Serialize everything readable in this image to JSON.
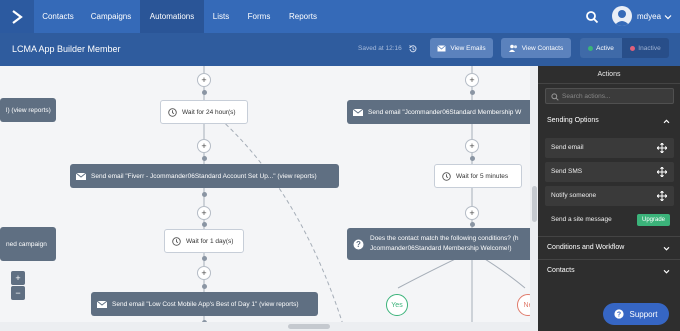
{
  "nav": {
    "items": [
      "Contacts",
      "Campaigns",
      "Automations",
      "Lists",
      "Forms",
      "Reports"
    ],
    "active": "Automations",
    "user": "mdyea"
  },
  "header": {
    "title": "LCMA App Builder Member",
    "saved": "Saved at 12:16",
    "view_emails": "View Emails",
    "view_contacts": "View Contacts",
    "active_label": "Active",
    "inactive_label": "Inactive"
  },
  "canvas": {
    "left_top_node": "l) (view reports)",
    "left_mid_node": "ned campaign",
    "wait1": "Wait for 24 hour(s)",
    "email1": "Send email \"Fiverr - Jcommander06Standard Account Set Up...\" (view reports)",
    "wait2": "Wait for 1 day(s)",
    "email2": "Send email \"Low Cost Mobile App's Best of Day 1\" (view reports)",
    "right_email": "Send email \"Jcommander06Standard Membership W",
    "wait_right": "Wait for 5 minutes",
    "condition_line1": "Does the contact match the following conditions? (h",
    "condition_line2": "Jcommander06Standard Membership Welcome!)",
    "yes": "Yes",
    "no": "Ne",
    "plus": "+",
    "zoom_in": "+",
    "zoom_out": "−"
  },
  "actions_panel": {
    "title": "Actions",
    "search_placeholder": "Search actions...",
    "sections": {
      "sending_options": "Sending Options",
      "conditions": "Conditions and Workflow",
      "contacts": "Contacts"
    },
    "items": [
      "Send email",
      "Send SMS",
      "Notify someone",
      "Send a site message"
    ],
    "upgrade": "Upgrade"
  },
  "support": "Support",
  "colors": {
    "nav_bg": "#356ab8",
    "sub_bg": "#2f5c9e",
    "node_dark": "#5f6f82",
    "active_green": "#3bb37a",
    "inactive_red": "#e0607a",
    "no_red": "#e07a6a"
  }
}
